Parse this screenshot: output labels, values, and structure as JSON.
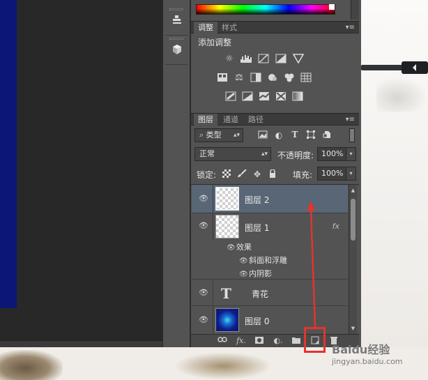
{
  "adjustments": {
    "tab_adjust": "调整",
    "tab_style": "样式",
    "title": "添加调整",
    "icons_row1": [
      "brightness-icon",
      "levels-icon",
      "curves-icon",
      "exposure-icon",
      "vibrance-icon"
    ],
    "icons_row2": [
      "hue-saturation-icon",
      "color-balance-icon",
      "black-white-icon",
      "photo-filter-icon",
      "channel-mixer-icon",
      "color-lookup-icon"
    ],
    "icons_row3": [
      "invert-icon",
      "posterize-icon",
      "threshold-icon",
      "selective-color-icon",
      "gradient-map-icon"
    ]
  },
  "layers_panel": {
    "tabs": [
      "图层",
      "通道",
      "路径"
    ],
    "filter_kind": "类型",
    "blend_mode": "正常",
    "opacity_label": "不透明度:",
    "opacity_value": "100%",
    "lock_label": "锁定:",
    "fill_label": "填充:",
    "fill_value": "100%",
    "layers": [
      {
        "name": "图层 2",
        "selected": true
      },
      {
        "name": "图层 1",
        "fx": "fx"
      },
      {
        "name": "青花",
        "type_glyph": "T"
      },
      {
        "name": "图层 0"
      }
    ],
    "effects_label": "效果",
    "effects": [
      "斜面和浮雕",
      "内阴影"
    ]
  },
  "footer_icons": [
    "link-icon",
    "fx-icon",
    "add-mask-icon",
    "adjustment-layer-icon",
    "new-group-icon",
    "new-layer-icon",
    "delete-icon"
  ],
  "footer_fx": "fx.",
  "watermark": {
    "main": "Baidu经验",
    "sub": "jingyan.baidu.com"
  },
  "colors": {
    "panel": "#535353",
    "selected_layer": "#586675",
    "highlight": "#e3342f",
    "canvas": "#0c1775"
  }
}
